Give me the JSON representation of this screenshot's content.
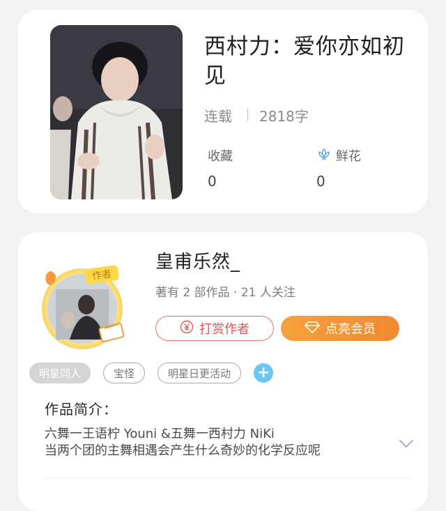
{
  "book": {
    "title": "西村力：爱你亦如初见",
    "status": "连载",
    "word_count": "2818字",
    "favorites_label": "收藏",
    "favorites_value": "0",
    "flowers_label": "鲜花",
    "flowers_value": "0"
  },
  "author": {
    "name": "皇甫乐然_",
    "stats": "著有 2 部作品 · 21 人关注",
    "badge": "作者",
    "tip_button": "打赏作者",
    "vip_button": "点亮会员"
  },
  "tags": [
    "明星同人",
    "宝怪",
    "明星日更活动"
  ],
  "intro": {
    "title": "作品简介：",
    "line1": "六舞一王语柠 Youni &五舞一西村力 NiKi",
    "line2": "当两个团的主舞相遇会产生什么奇妙的化学反应呢"
  },
  "colors": {
    "tip": "#e0564d",
    "vip": "#f08a30",
    "flower_icon": "#4aa8d8",
    "expand": "#b8a0e6"
  }
}
